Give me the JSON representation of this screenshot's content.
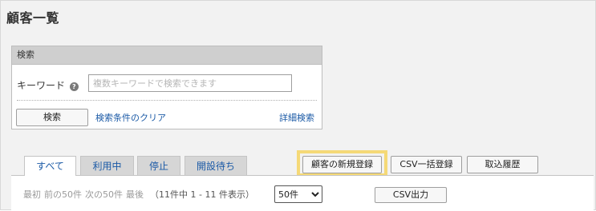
{
  "page": {
    "title": "顧客一覧"
  },
  "search": {
    "header": "検索",
    "keyword_label": "キーワード",
    "help_icon": "?",
    "keyword_placeholder": "複数キーワードで検索できます",
    "keyword_value": "",
    "search_button": "検索",
    "clear_link": "検索条件のクリア",
    "detail_link": "詳細検索"
  },
  "tabs": [
    {
      "label": "すべて",
      "active": true
    },
    {
      "label": "利用中",
      "active": false
    },
    {
      "label": "停止",
      "active": false
    },
    {
      "label": "開設待ち",
      "active": false
    }
  ],
  "actions": {
    "new_registration": "顧客の新規登録",
    "csv_bulk": "CSV一括登録",
    "import_history": "取込履歴"
  },
  "list": {
    "first": "最初",
    "prev": "前の50件",
    "next": "次の50件",
    "last": "最後",
    "count_text": "（11件中 1 - 11 件表示）",
    "per_page_selected": "50件",
    "csv_output": "CSV出力"
  },
  "colors": {
    "highlight": "#f5d977",
    "link": "#1b5aa6",
    "panel_header": "#cfcfcf",
    "background": "#f2f2f2"
  }
}
